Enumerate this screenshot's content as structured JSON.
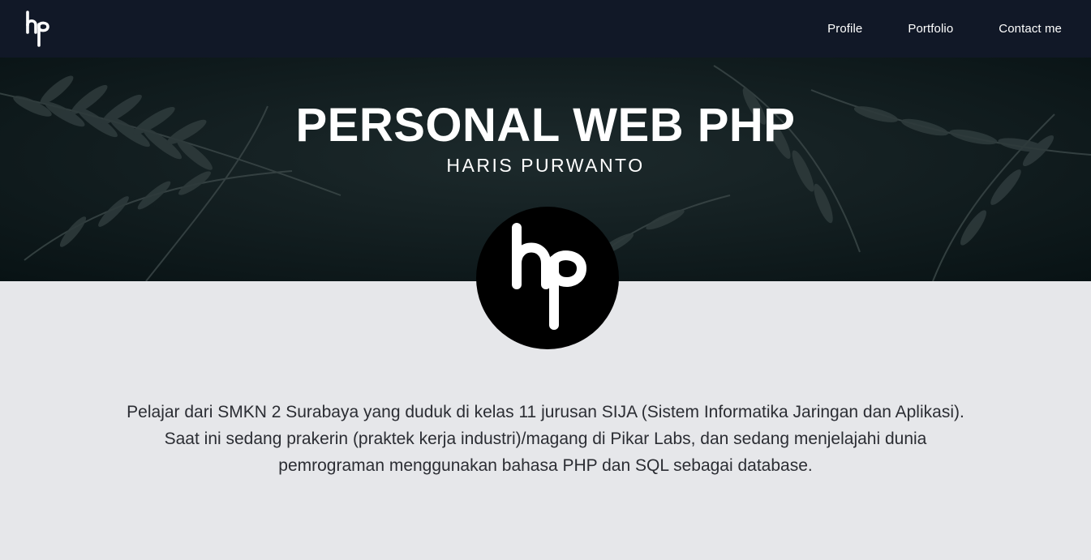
{
  "navbar": {
    "logo_icon": "hp-logo-icon",
    "links": [
      {
        "label": "Profile"
      },
      {
        "label": "Portfolio"
      },
      {
        "label": "Contact me"
      }
    ],
    "colors": {
      "background": "#111827",
      "text": "#ffffff"
    }
  },
  "hero": {
    "title": "PERSONAL WEB PHP",
    "subtitle": "HARIS PURWANTO",
    "background_icon": "fern-leaves-background"
  },
  "avatar": {
    "icon": "hp-logo-icon"
  },
  "about": {
    "lines": [
      "Pelajar dari SMKN 2 Surabaya yang duduk di kelas 11 jurusan SIJA (Sistem Informatika Jaringan dan Aplikasi).",
      "Saat ini sedang prakerin (praktek kerja industri)/magang di Pikar Labs, dan sedang menjelajahi dunia",
      "pemrograman menggunakan bahasa PHP dan SQL sebagai database."
    ]
  },
  "colors": {
    "page_background": "#e6e7ea",
    "hero_background": "#0d1a1c",
    "avatar_background": "#000000"
  }
}
